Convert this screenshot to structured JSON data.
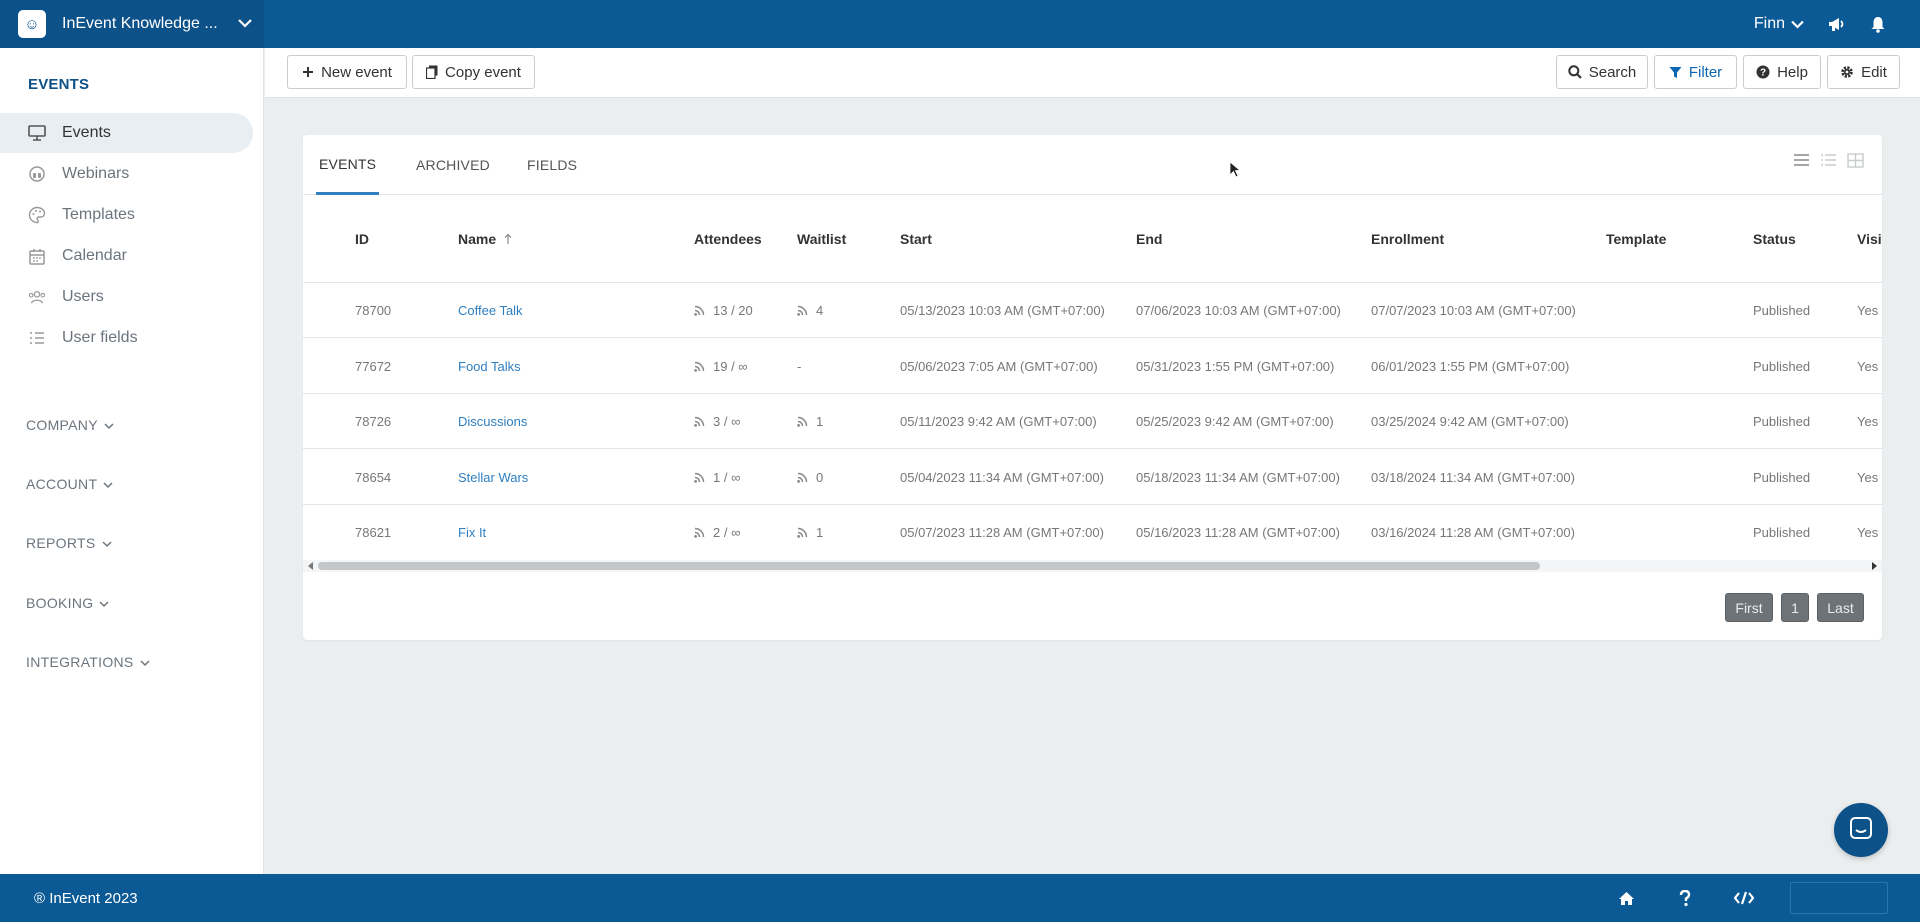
{
  "topbar": {
    "brand_name": "InEvent Knowledge ...",
    "user_name": "Finn",
    "icons": [
      "chevron-down-icon",
      "megaphone-icon",
      "bell-icon"
    ]
  },
  "sidebar": {
    "heading": "EVENTS",
    "items": [
      {
        "label": "Events",
        "icon": "presentation-icon",
        "active": true
      },
      {
        "label": "Webinars",
        "icon": "headset-icon",
        "active": false
      },
      {
        "label": "Templates",
        "icon": "palette-icon",
        "active": false
      },
      {
        "label": "Calendar",
        "icon": "calendar-icon",
        "active": false
      },
      {
        "label": "Users",
        "icon": "users-icon",
        "active": false
      },
      {
        "label": "User fields",
        "icon": "list-icon",
        "active": false
      }
    ],
    "sections": [
      "COMPANY",
      "ACCOUNT",
      "REPORTS",
      "BOOKING",
      "INTEGRATIONS"
    ]
  },
  "toolbar": {
    "new_event": "New event",
    "copy_event": "Copy event",
    "search": "Search",
    "filter": "Filter",
    "help": "Help",
    "edit": "Edit"
  },
  "tabs": [
    "EVENTS",
    "ARCHIVED",
    "FIELDS"
  ],
  "table": {
    "columns": [
      "ID",
      "Name",
      "Attendees",
      "Waitlist",
      "Start",
      "End",
      "Enrollment",
      "Template",
      "Status",
      "Visil"
    ],
    "rows": [
      {
        "id": "78700",
        "name": "Coffee Talk",
        "attendees": "13 / 20",
        "waitlist": "4",
        "waitlist_icon": true,
        "start": "05/13/2023 10:03 AM (GMT+07:00)",
        "end": "07/06/2023 10:03 AM (GMT+07:00)",
        "enrollment": "07/07/2023 10:03 AM (GMT+07:00)",
        "template": "",
        "status": "Published",
        "visible": "Yes"
      },
      {
        "id": "77672",
        "name": "Food Talks",
        "attendees": "19 / ∞",
        "waitlist": "-",
        "waitlist_icon": false,
        "start": "05/06/2023 7:05 AM (GMT+07:00)",
        "end": "05/31/2023 1:55 PM (GMT+07:00)",
        "enrollment": "06/01/2023 1:55 PM (GMT+07:00)",
        "template": "",
        "status": "Published",
        "visible": "Yes"
      },
      {
        "id": "78726",
        "name": "Discussions",
        "attendees": "3 / ∞",
        "waitlist": "1",
        "waitlist_icon": true,
        "start": "05/11/2023 9:42 AM (GMT+07:00)",
        "end": "05/25/2023 9:42 AM (GMT+07:00)",
        "enrollment": "03/25/2024 9:42 AM (GMT+07:00)",
        "template": "",
        "status": "Published",
        "visible": "Yes"
      },
      {
        "id": "78654",
        "name": "Stellar Wars",
        "attendees": "1 / ∞",
        "waitlist": "0",
        "waitlist_icon": true,
        "start": "05/04/2023 11:34 AM (GMT+07:00)",
        "end": "05/18/2023 11:34 AM (GMT+07:00)",
        "enrollment": "03/18/2024 11:34 AM (GMT+07:00)",
        "template": "",
        "status": "Published",
        "visible": "Yes"
      },
      {
        "id": "78621",
        "name": "Fix It",
        "attendees": "2 / ∞",
        "waitlist": "1",
        "waitlist_icon": true,
        "start": "05/07/2023 11:28 AM (GMT+07:00)",
        "end": "05/16/2023 11:28 AM (GMT+07:00)",
        "enrollment": "03/16/2024 11:28 AM (GMT+07:00)",
        "template": "",
        "status": "Published",
        "visible": "Yes"
      }
    ]
  },
  "pagination": {
    "first": "First",
    "page": "1",
    "last": "Last"
  },
  "footer": {
    "copyright": "® InEvent 2023"
  },
  "colors": {
    "brand": "#0b5a96",
    "link": "#2f7fc1",
    "active_tab": "#2f7fc1"
  }
}
